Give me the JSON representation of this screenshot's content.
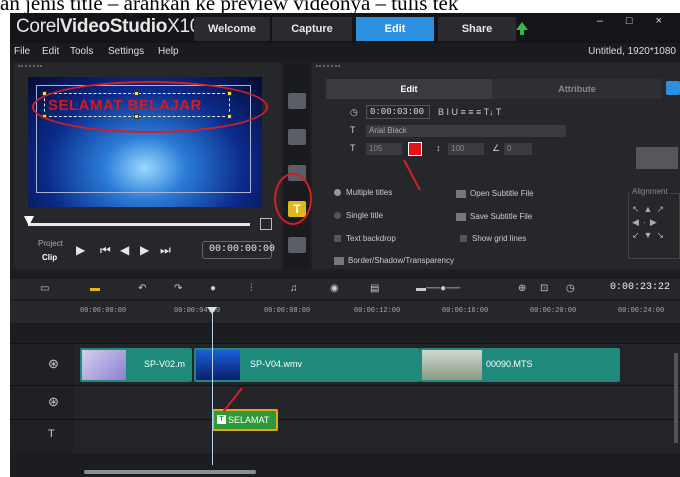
{
  "caption": "an jenis title – arahkan ke preview videonya – tulis tek",
  "app": {
    "brand_prefix": "Corel",
    "brand_name": "VideoStudio",
    "brand_version": "X10",
    "tabs": [
      {
        "label": "Welcome"
      },
      {
        "label": "Capture"
      },
      {
        "label": "Edit"
      },
      {
        "label": "Share"
      }
    ],
    "window_controls": "– □ ×",
    "menu": [
      {
        "label": "File"
      },
      {
        "label": "Edit"
      },
      {
        "label": "Tools"
      },
      {
        "label": "Settings"
      },
      {
        "label": "Help"
      }
    ],
    "project_title": "Untitled, 1920*1080"
  },
  "preview": {
    "overlay_text": "SELAMAT BELAJAR",
    "project_label": "Project",
    "clip_label": "Clip",
    "timecode": "00:00:00:00"
  },
  "options": {
    "tab_edit": "Edit",
    "tab_attribute": "Attribute",
    "duration": "0:00:03:00",
    "font": "Arial Black",
    "font_size": "105",
    "line_spacing": "100",
    "angle": "0",
    "text_color": "#e2141a",
    "multiple_titles": "Multiple titles",
    "single_title": "Single title",
    "open_subtitle": "Open Subtitle File",
    "save_subtitle": "Save Subtitle File",
    "text_backdrop": "Text backdrop",
    "show_grid": "Show grid lines",
    "border_shadow": "Border/Shadow/Transparency",
    "alignment_label": "Alignment"
  },
  "timeline": {
    "current_time": "0:00:23:22",
    "ruler_ticks": [
      "00:00:00:00",
      "00:00:04:00",
      "00:00:08:00",
      "00:00:12:00",
      "00:00:16:00",
      "00:00:20:00",
      "00:00:24:00"
    ],
    "clips": [
      {
        "name": "SP-V02.m"
      },
      {
        "name": "SP-V04.wmv"
      },
      {
        "name": "00090.MTS"
      }
    ],
    "title_clip": "SELAMAT"
  }
}
